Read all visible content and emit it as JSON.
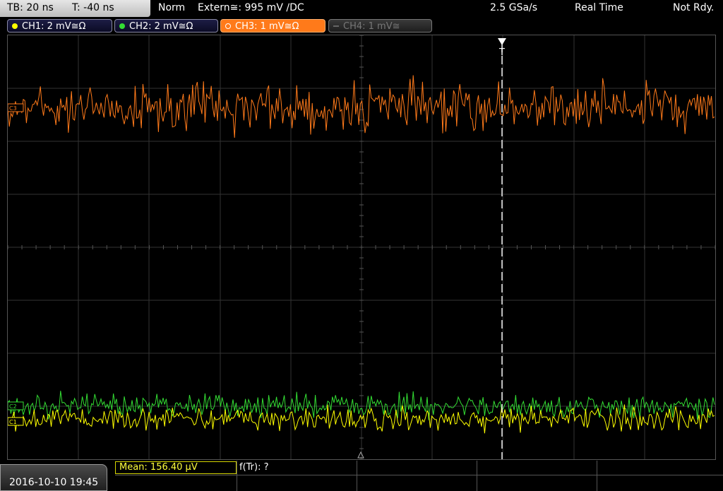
{
  "timebase": {
    "tb_label": "TB: 20 ns",
    "trigger_time": "T: -40 ns"
  },
  "status": {
    "mode": "Norm",
    "trigger_source": "Extern≅: 995 mV ∕DC",
    "sample_rate": "2.5 GSa/s",
    "acquisition": "Real Time",
    "ready_state": "Not Rdy."
  },
  "channels": [
    {
      "label": "CH1: 2 mV≅Ω",
      "color": "#ffff00",
      "state": "on"
    },
    {
      "label": "CH2: 2 mV≅Ω",
      "color": "#33dd33",
      "state": "on"
    },
    {
      "label": "CH3: 1 mV≅Ω",
      "color": "#ff7a1a",
      "state": "active"
    },
    {
      "label": "CH4: 1 mV≅",
      "color": "#666666",
      "state": "off"
    }
  ],
  "markers": {
    "ch3": "C3",
    "ch2": "C2",
    "ch1": "C1",
    "trigger": "T"
  },
  "footer": {
    "datetime": "2016-10-10 19:45",
    "mean_label": "Mean: 156.40 µV",
    "ftr_label": "f(Tr): ?"
  },
  "colors": {
    "grid": "#333333",
    "ch1": "#ffff00",
    "ch2": "#33dd33",
    "ch3": "#ff7a1a"
  }
}
